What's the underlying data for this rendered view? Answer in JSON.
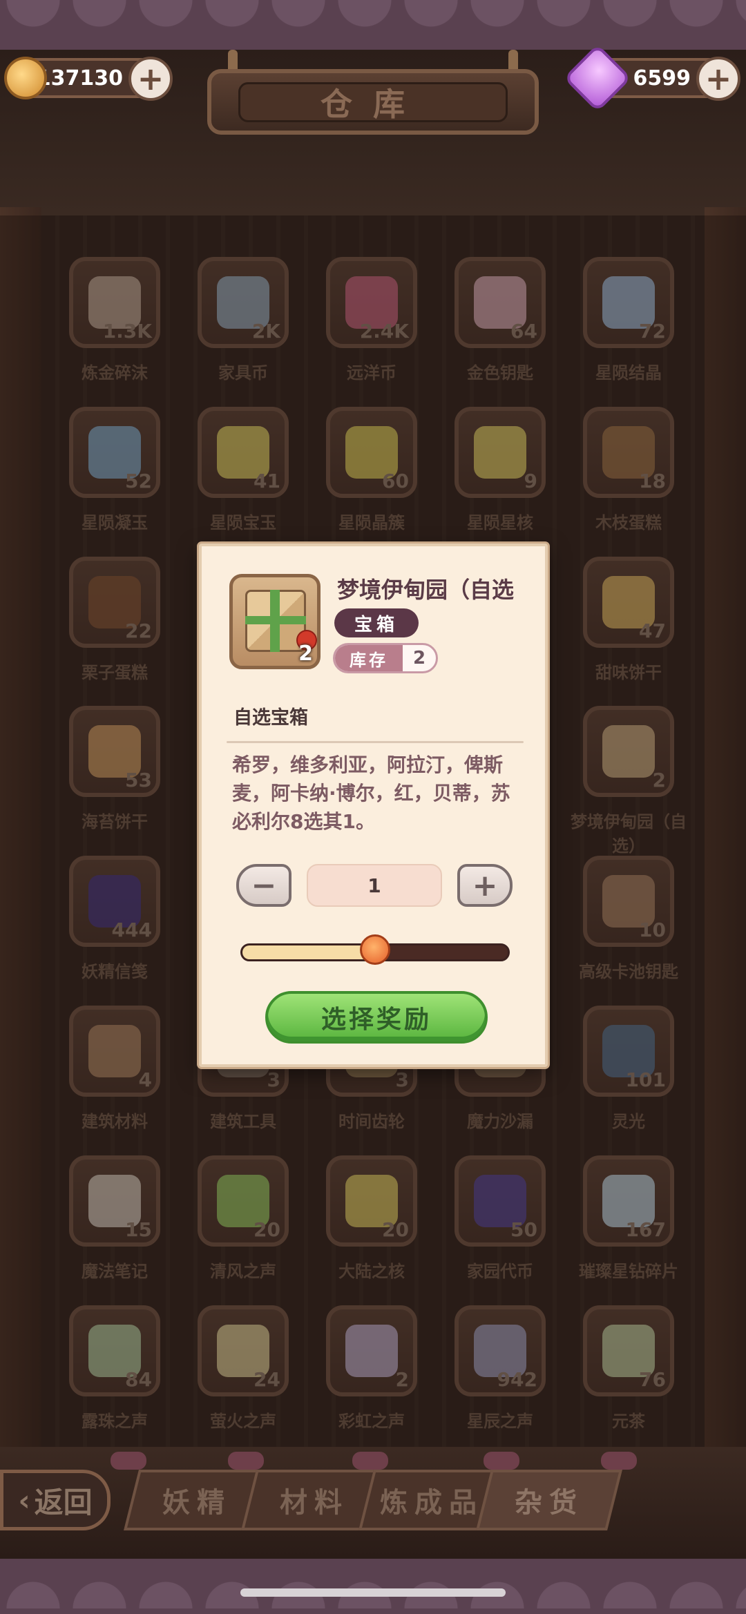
{
  "header": {
    "title": "仓库",
    "gold": {
      "value": "137130",
      "icon": "coin-icon"
    },
    "gems": {
      "value": "6599",
      "icon": "gem-icon"
    },
    "plus_icon": "plus-icon"
  },
  "inventory": {
    "rows": [
      [
        {
          "name": "炼金碎沫",
          "count": "1.3K",
          "color": "#c9b3a0"
        },
        {
          "name": "家具币",
          "count": "2K",
          "color": "#9fb7c9"
        },
        {
          "name": "远洋币",
          "count": "2.4K",
          "color": "#d26a86"
        },
        {
          "name": "金色钥匙",
          "count": "64",
          "color": "#e4b5c1"
        },
        {
          "name": "星陨结晶",
          "count": "72",
          "color": "#a8c7e6"
        }
      ],
      [
        {
          "name": "星陨凝玉",
          "count": "52",
          "color": "#8ab7d8"
        },
        {
          "name": "星陨宝玉",
          "count": "41",
          "color": "#e8d96a"
        },
        {
          "name": "星陨晶簇",
          "count": "60",
          "color": "#e6d65f"
        },
        {
          "name": "星陨星核",
          "count": "9",
          "color": "#e9d86b"
        },
        {
          "name": "木枝蛋糕",
          "count": "18",
          "color": "#a57a4c"
        }
      ],
      [
        {
          "name": "栗子蛋糕",
          "count": "22",
          "color": "#8a5a3a"
        },
        {
          "name": "",
          "count": "",
          "color": ""
        },
        {
          "name": "",
          "count": "",
          "color": ""
        },
        {
          "name": "",
          "count": "",
          "color": ""
        },
        {
          "name": "甜味饼干",
          "count": "47",
          "color": "#e8c06a"
        }
      ],
      [
        {
          "name": "海苔饼干",
          "count": "53",
          "color": "#d9a56a"
        },
        {
          "name": "",
          "count": "",
          "color": ""
        },
        {
          "name": "",
          "count": "",
          "color": ""
        },
        {
          "name": "",
          "count": "",
          "color": ""
        },
        {
          "name": "梦境伊甸园（自选）",
          "count": "2",
          "color": "#d6b88a"
        }
      ],
      [
        {
          "name": "妖精信笺",
          "count": "444",
          "color": "#4a3a8a"
        },
        {
          "name": "",
          "count": "",
          "color": ""
        },
        {
          "name": "",
          "count": "",
          "color": ""
        },
        {
          "name": "",
          "count": "",
          "color": ""
        },
        {
          "name": "高级卡池钥匙",
          "count": "10",
          "color": "#b08a6a"
        }
      ],
      [
        {
          "name": "建筑材料",
          "count": "4",
          "color": "#b58d6a"
        },
        {
          "name": "建筑工具",
          "count": "3",
          "color": "#9b8a7a"
        },
        {
          "name": "时间齿轮",
          "count": "3",
          "color": "#b59a6a"
        },
        {
          "name": "魔力沙漏",
          "count": "",
          "color": "#a58a6a"
        },
        {
          "name": "灵光",
          "count": "101",
          "color": "#5a7a9a"
        }
      ],
      [
        {
          "name": "魔法笔记",
          "count": "15",
          "color": "#e0d6c8"
        },
        {
          "name": "清风之声",
          "count": "20",
          "color": "#9fd46a"
        },
        {
          "name": "大陆之核",
          "count": "20",
          "color": "#e8d66a"
        },
        {
          "name": "家园代币",
          "count": "50",
          "color": "#5a4aa0"
        },
        {
          "name": "璀璨星钻碎片",
          "count": "167",
          "color": "#c8e0ee"
        }
      ],
      [
        {
          "name": "露珠之声",
          "count": "84",
          "color": "#b9d6a8"
        },
        {
          "name": "萤火之声",
          "count": "24",
          "color": "#e8d9a0"
        },
        {
          "name": "彩虹之声",
          "count": "2",
          "color": "#c8b8d8"
        },
        {
          "name": "星辰之声",
          "count": "942",
          "color": "#a8a8c8"
        },
        {
          "name": "元茶",
          "count": "76",
          "color": "#c8d8a8"
        }
      ]
    ]
  },
  "tabs": {
    "back": "返回",
    "items": [
      "妖精",
      "材料",
      "炼成品",
      "杂货"
    ],
    "active": 3
  },
  "modal": {
    "item_name": "梦境伊甸园（自选",
    "item_qty": "2",
    "type_badge": "宝箱",
    "stock_label": "库存",
    "stock_value": "2",
    "desc_title": "自选宝箱",
    "desc_body": "希罗，维多利亚，阿拉汀，俾斯麦，阿卡纳·博尔，红，贝蒂，苏必利尔8选其1。",
    "quantity": "1",
    "slider_fraction": 0.5,
    "confirm_label": "选择奖励"
  }
}
